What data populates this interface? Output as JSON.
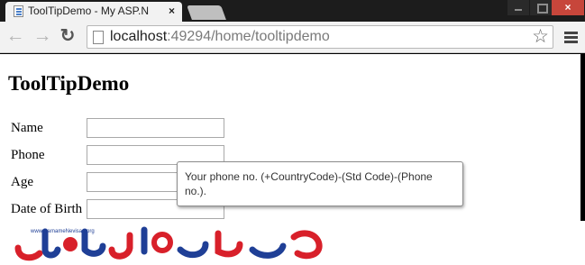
{
  "browser": {
    "tab_title": "ToolTipDemo - My ASP.N",
    "tab_close": "×",
    "close_glyph": "×",
    "url_host": "localhost",
    "url_path": ":49294/home/tooltipdemo",
    "star_glyph": "☆",
    "back_glyph": "←",
    "forward_glyph": "→",
    "reload_glyph": "↻"
  },
  "page": {
    "heading": "ToolTipDemo",
    "fields": [
      {
        "label": "Name",
        "value": ""
      },
      {
        "label": "Phone",
        "value": ""
      },
      {
        "label": "Age",
        "value": ""
      },
      {
        "label": "Date of Birth",
        "value": ""
      }
    ],
    "tooltip": "Your phone no. (+CountryCode)-(Std Code)-(Phone no.)."
  },
  "watermark": {
    "site_text": "www.BarnameNevisan.org",
    "logo_text": "برنامه نویسان",
    "colors": {
      "blue": "#1f3f96",
      "red": "#d8202a"
    }
  }
}
